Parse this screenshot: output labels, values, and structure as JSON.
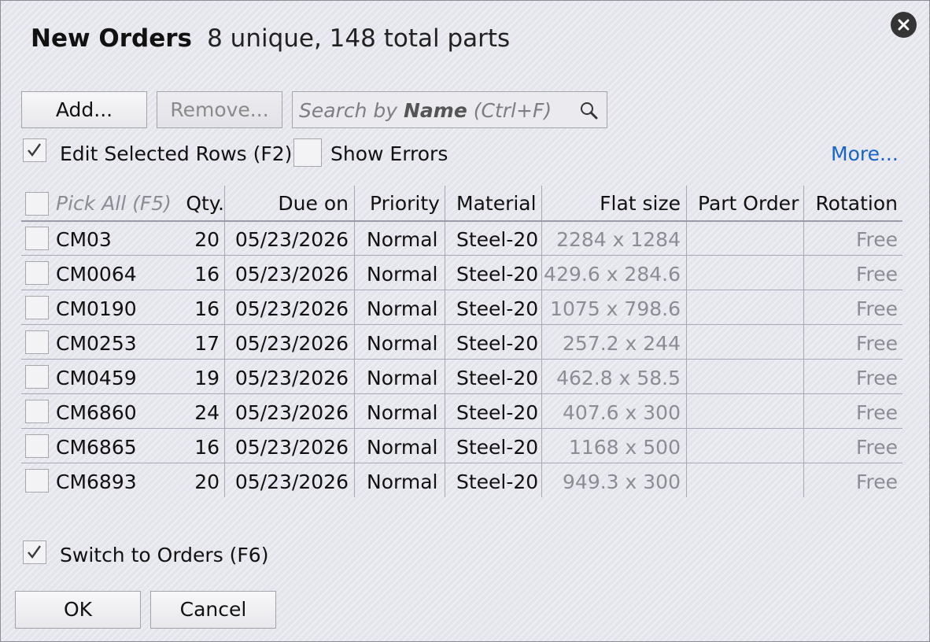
{
  "dialog": {
    "title": "New Orders",
    "subtitle": "8 unique, 148 total parts"
  },
  "toolbar": {
    "add_label": "Add...",
    "remove_label": "Remove...",
    "search_prefix": "Search by ",
    "search_bold": "Name",
    "search_suffix": " (Ctrl+F)",
    "edit_selected_label": "Edit Selected Rows (F2)",
    "edit_selected_checked": true,
    "show_errors_label": "Show Errors",
    "show_errors_checked": false,
    "more_label": "More..."
  },
  "table": {
    "headers": {
      "pick_all": "Pick All (F5)",
      "qty": "Qty.",
      "due": "Due on",
      "priority": "Priority",
      "material": "Material",
      "flat_size": "Flat size",
      "part_order": "Part Order",
      "rotation": "Rotation"
    },
    "rows": [
      {
        "name": "CM03",
        "qty": "20",
        "due": "05/23/2026",
        "priority": "Normal",
        "material": "Steel-20",
        "flat_size": "2284 x 1284",
        "part_order": "",
        "rotation": "Free"
      },
      {
        "name": "CM0064",
        "qty": "16",
        "due": "05/23/2026",
        "priority": "Normal",
        "material": "Steel-20",
        "flat_size": "429.6 x 284.6",
        "part_order": "",
        "rotation": "Free"
      },
      {
        "name": "CM0190",
        "qty": "16",
        "due": "05/23/2026",
        "priority": "Normal",
        "material": "Steel-20",
        "flat_size": "1075 x 798.6",
        "part_order": "",
        "rotation": "Free"
      },
      {
        "name": "CM0253",
        "qty": "17",
        "due": "05/23/2026",
        "priority": "Normal",
        "material": "Steel-20",
        "flat_size": "257.2 x 244",
        "part_order": "",
        "rotation": "Free"
      },
      {
        "name": "CM0459",
        "qty": "19",
        "due": "05/23/2026",
        "priority": "Normal",
        "material": "Steel-20",
        "flat_size": "462.8 x 58.5",
        "part_order": "",
        "rotation": "Free"
      },
      {
        "name": "CM6860",
        "qty": "24",
        "due": "05/23/2026",
        "priority": "Normal",
        "material": "Steel-20",
        "flat_size": "407.6 x 300",
        "part_order": "",
        "rotation": "Free"
      },
      {
        "name": "CM6865",
        "qty": "16",
        "due": "05/23/2026",
        "priority": "Normal",
        "material": "Steel-20",
        "flat_size": "1168 x 500",
        "part_order": "",
        "rotation": "Free"
      },
      {
        "name": "CM6893",
        "qty": "20",
        "due": "05/23/2026",
        "priority": "Normal",
        "material": "Steel-20",
        "flat_size": "949.3 x 300",
        "part_order": "",
        "rotation": "Free"
      }
    ]
  },
  "footer": {
    "switch_label": "Switch to Orders (F6)",
    "switch_checked": true,
    "ok_label": "OK",
    "cancel_label": "Cancel"
  },
  "colors": {
    "link": "#1a64c6",
    "muted_text": "#8c8c94",
    "close_button": "#353535"
  },
  "icons": {
    "close": "close-icon",
    "search": "search-icon",
    "check": "checkmark-icon"
  }
}
